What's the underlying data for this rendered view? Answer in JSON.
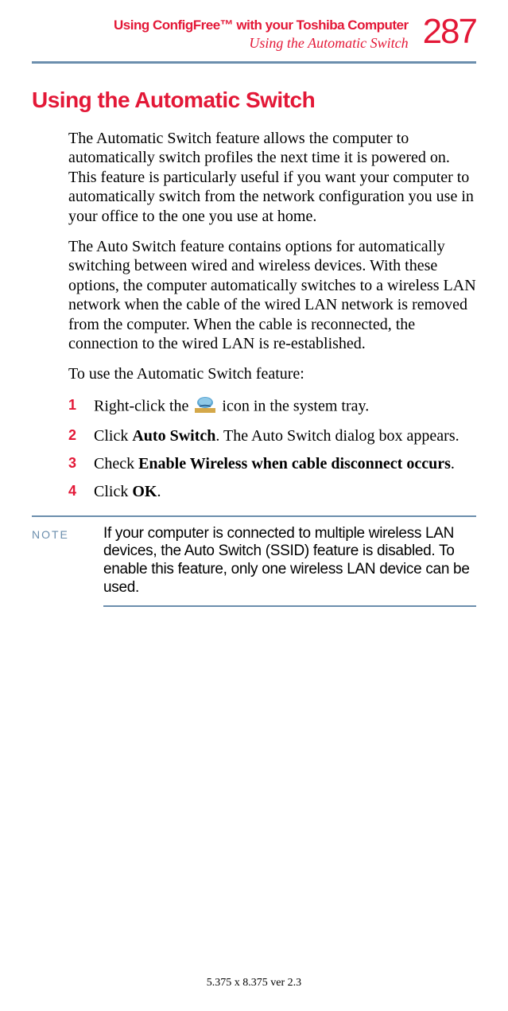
{
  "header": {
    "title": "Using ConfigFree™ with your Toshiba Computer",
    "subtitle": "Using the Automatic Switch",
    "page_number": "287"
  },
  "main_heading": "Using the Automatic Switch",
  "paragraphs": {
    "p1": "The Automatic Switch feature allows the computer to automatically switch profiles the next time it is powered on. This feature is particularly useful if you want your computer to automatically switch from the network configuration you use in your office to the one you use at home.",
    "p2": "The Auto Switch feature contains options for automatically switching between wired and wireless devices. With these options, the computer automatically switches to a wireless LAN network when the cable of the wired LAN network is removed from the computer. When the cable is reconnected, the connection to the wired LAN is re-established.",
    "p3": "To use the Automatic Switch feature:"
  },
  "steps": {
    "s1": {
      "num": "1",
      "pre": "Right-click the ",
      "post": " icon in the system tray."
    },
    "s2": {
      "num": "2",
      "pre": "Click ",
      "bold": "Auto Switch",
      "post": ". The Auto Switch dialog box appears."
    },
    "s3": {
      "num": "3",
      "pre": "Check ",
      "bold": "Enable Wireless when cable disconnect occurs",
      "post": "."
    },
    "s4": {
      "num": "4",
      "pre": "Click ",
      "bold": "OK",
      "post": "."
    }
  },
  "note": {
    "label": "NOTE",
    "text": "If your computer is connected to multiple wireless LAN devices, the Auto Switch (SSID) feature is disabled. To enable this feature, only one wireless LAN device can be used."
  },
  "footer": "5.375 x 8.375 ver 2.3"
}
